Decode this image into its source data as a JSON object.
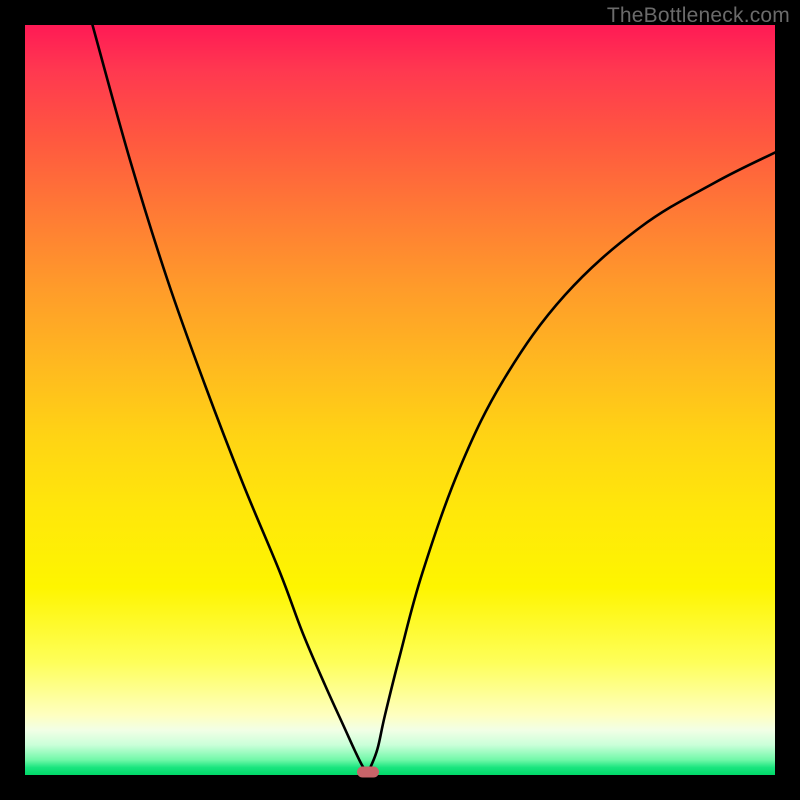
{
  "watermark": "TheBottleneck.com",
  "chart_data": {
    "type": "line",
    "title": "",
    "xlabel": "",
    "ylabel": "",
    "xlim": [
      0,
      100
    ],
    "ylim": [
      0,
      100
    ],
    "grid": false,
    "legend": false,
    "series": [
      {
        "name": "curve",
        "x": [
          9,
          14,
          19,
          24,
          29,
          34,
          37,
          40,
          42.5,
          44,
          45,
          45.7,
          46,
          47,
          48,
          50,
          53,
          58,
          64,
          72,
          82,
          92,
          100
        ],
        "y": [
          100,
          82,
          66,
          52,
          39,
          27,
          19,
          12,
          6.5,
          3.2,
          1.2,
          0.4,
          0.9,
          3.5,
          8,
          16,
          27,
          41,
          53,
          64,
          73,
          79,
          83
        ]
      }
    ],
    "marker": {
      "x": 45.7,
      "y": 0.4,
      "color": "#c76469"
    },
    "gradient_stops": [
      {
        "pos": 0,
        "color": "#ff1a55"
      },
      {
        "pos": 35,
        "color": "#ff9b2a"
      },
      {
        "pos": 65,
        "color": "#ffe80a"
      },
      {
        "pos": 92,
        "color": "#feffc0"
      },
      {
        "pos": 100,
        "color": "#00d968"
      }
    ]
  }
}
